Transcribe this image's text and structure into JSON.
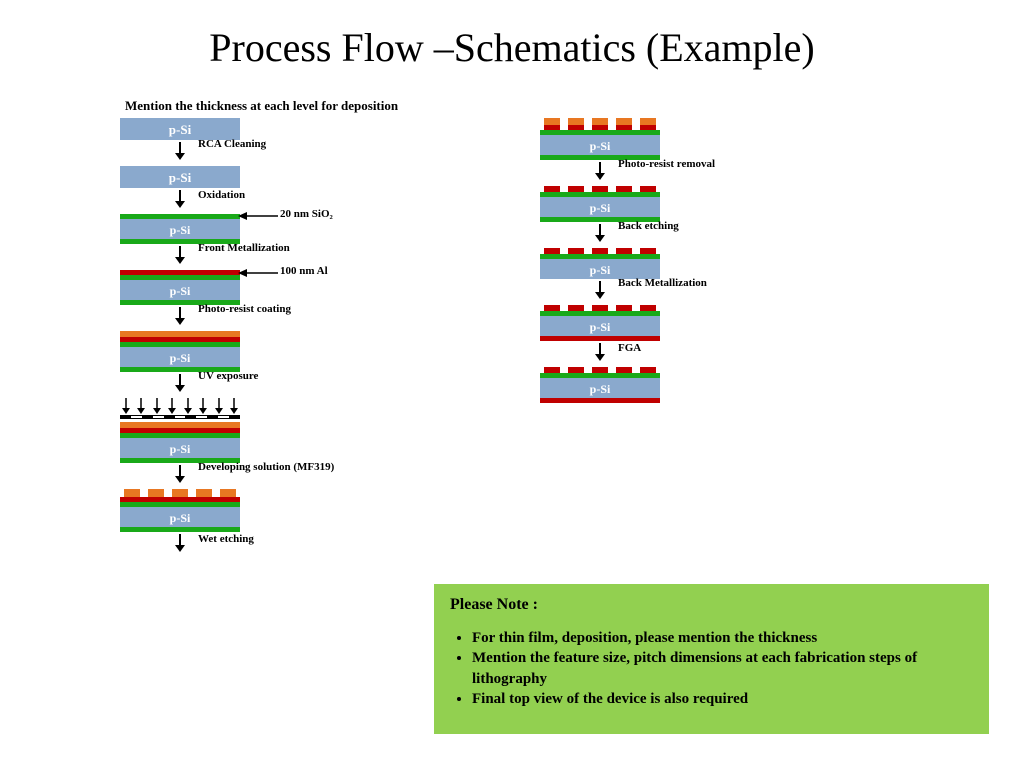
{
  "title": "Process Flow –Schematics (Example)",
  "subtitle": "Mention the thickness at each level for deposition",
  "substrate": "p-Si",
  "steps_left": {
    "rca": "RCA Cleaning",
    "oxidation": "Oxidation",
    "sio2": "20 nm SiO₂",
    "front_metal": "Front Metallization",
    "al": "100 nm Al",
    "pr_coat": "Photo-resist coating",
    "uv": "UV exposure",
    "develop": "Developing solution (MF319)",
    "wet_etch": "Wet etching"
  },
  "steps_right": {
    "pr_removal": "Photo-resist removal",
    "back_etch": "Back etching",
    "back_metal": "Back Metallization",
    "fga": "FGA"
  },
  "note": {
    "title": "Please Note :",
    "items": [
      "For thin film, deposition, please mention the thickness",
      "Mention the feature size, pitch dimensions at each fabrication steps of lithography",
      "Final top view of the device is also required"
    ]
  }
}
